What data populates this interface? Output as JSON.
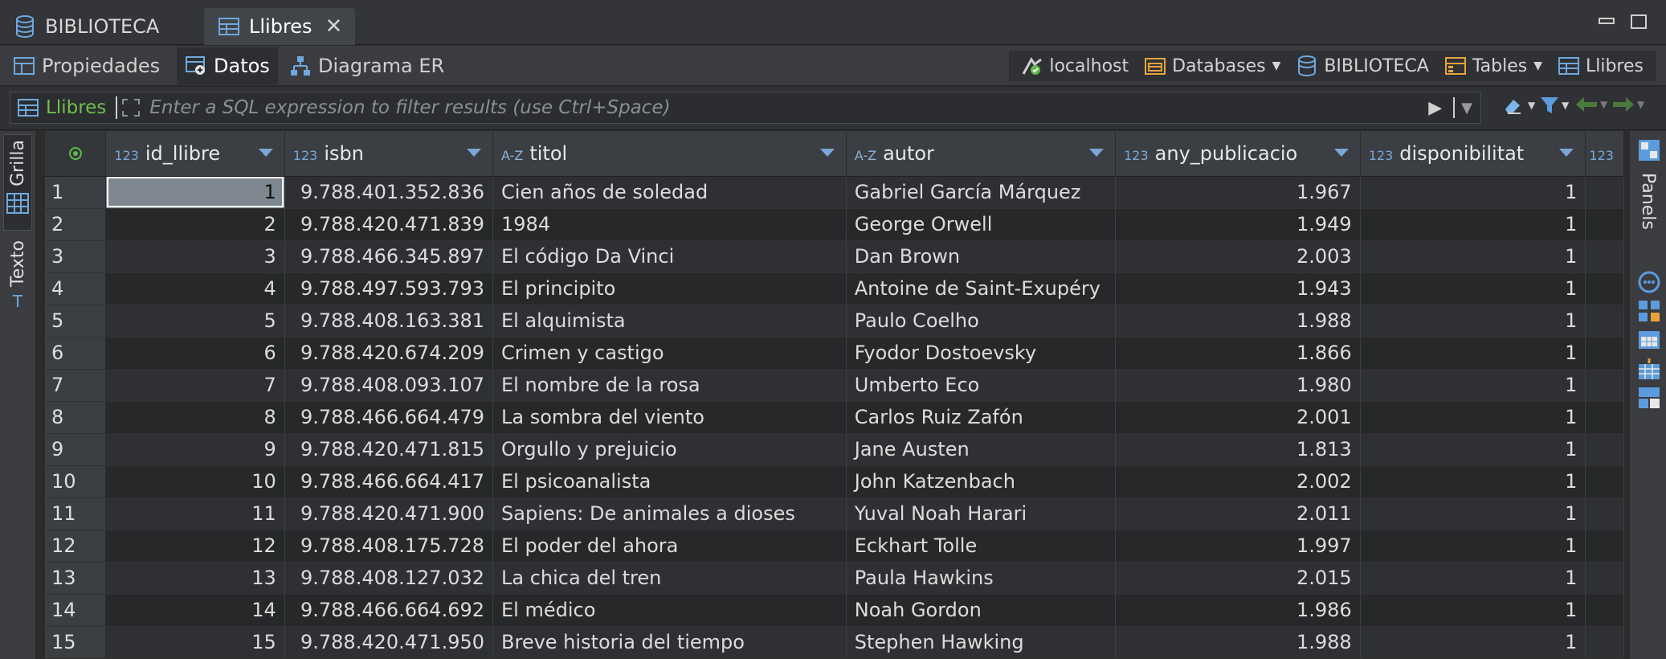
{
  "tabs": [
    {
      "label": "BIBLIOTECA",
      "icon": "database-icon",
      "active": false
    },
    {
      "label": "Llibres",
      "icon": "table-icon",
      "active": true
    }
  ],
  "subtabs": [
    {
      "label": "Propiedades",
      "icon": "properties-icon"
    },
    {
      "label": "Datos",
      "icon": "data-icon"
    },
    {
      "label": "Diagrama ER",
      "icon": "er-diagram-icon"
    }
  ],
  "breadcrumb": [
    {
      "label": "localhost",
      "icon": "connection-icon",
      "dropdown": false
    },
    {
      "label": "Databases",
      "icon": "folder-icon",
      "dropdown": true
    },
    {
      "label": "BIBLIOTECA",
      "icon": "database-icon",
      "dropdown": false
    },
    {
      "label": "Tables",
      "icon": "tables-folder-icon",
      "dropdown": true
    },
    {
      "label": "Llibres",
      "icon": "table-icon",
      "dropdown": false
    }
  ],
  "filter": {
    "table": "Llibres",
    "placeholder": "Enter a SQL expression to filter results (use Ctrl+Space)"
  },
  "side_tabs": {
    "grid": "Grilla",
    "text": "Texto",
    "panels": "Panels"
  },
  "columns": [
    {
      "name": "id_llibre",
      "type": "123",
      "key": true
    },
    {
      "name": "isbn",
      "type": "123",
      "key": true
    },
    {
      "name": "titol",
      "type": "A-Z",
      "key": false
    },
    {
      "name": "autor",
      "type": "A-Z",
      "key": false
    },
    {
      "name": "any_publicacio",
      "type": "123",
      "key": false
    },
    {
      "name": "disponibilitat",
      "type": "123",
      "key": false
    },
    {
      "name": "",
      "type": "123",
      "key": false
    }
  ],
  "rows": [
    {
      "n": "1",
      "id": "1",
      "isbn": "9.788.401.352.836",
      "titol": "Cien años de soledad",
      "autor": "Gabriel García Márquez",
      "any": "1.967",
      "disp": "1"
    },
    {
      "n": "2",
      "id": "2",
      "isbn": "9.788.420.471.839",
      "titol": "1984",
      "autor": "George Orwell",
      "any": "1.949",
      "disp": "1"
    },
    {
      "n": "3",
      "id": "3",
      "isbn": "9.788.466.345.897",
      "titol": "El código Da Vinci",
      "autor": "Dan Brown",
      "any": "2.003",
      "disp": "1"
    },
    {
      "n": "4",
      "id": "4",
      "isbn": "9.788.497.593.793",
      "titol": "El principito",
      "autor": "Antoine de Saint-Exupéry",
      "any": "1.943",
      "disp": "1"
    },
    {
      "n": "5",
      "id": "5",
      "isbn": "9.788.408.163.381",
      "titol": "El alquimista",
      "autor": "Paulo Coelho",
      "any": "1.988",
      "disp": "1"
    },
    {
      "n": "6",
      "id": "6",
      "isbn": "9.788.420.674.209",
      "titol": "Crimen y castigo",
      "autor": "Fyodor Dostoevsky",
      "any": "1.866",
      "disp": "1"
    },
    {
      "n": "7",
      "id": "7",
      "isbn": "9.788.408.093.107",
      "titol": "El nombre de la rosa",
      "autor": "Umberto Eco",
      "any": "1.980",
      "disp": "1"
    },
    {
      "n": "8",
      "id": "8",
      "isbn": "9.788.466.664.479",
      "titol": "La sombra del viento",
      "autor": "Carlos Ruiz Zafón",
      "any": "2.001",
      "disp": "1"
    },
    {
      "n": "9",
      "id": "9",
      "isbn": "9.788.420.471.815",
      "titol": "Orgullo y prejuicio",
      "autor": "Jane Austen",
      "any": "1.813",
      "disp": "1"
    },
    {
      "n": "10",
      "id": "10",
      "isbn": "9.788.466.664.417",
      "titol": "El psicoanalista",
      "autor": "John Katzenbach",
      "any": "2.002",
      "disp": "1"
    },
    {
      "n": "11",
      "id": "11",
      "isbn": "9.788.420.471.900",
      "titol": "Sapiens: De animales a dioses",
      "autor": "Yuval Noah Harari",
      "any": "2.011",
      "disp": "1"
    },
    {
      "n": "12",
      "id": "12",
      "isbn": "9.788.408.175.728",
      "titol": "El poder del ahora",
      "autor": "Eckhart Tolle",
      "any": "1.997",
      "disp": "1"
    },
    {
      "n": "13",
      "id": "13",
      "isbn": "9.788.408.127.032",
      "titol": "La chica del tren",
      "autor": "Paula Hawkins",
      "any": "2.015",
      "disp": "1"
    },
    {
      "n": "14",
      "id": "14",
      "isbn": "9.788.466.664.692",
      "titol": "El médico",
      "autor": "Noah Gordon",
      "any": "1.986",
      "disp": "1"
    },
    {
      "n": "15",
      "id": "15",
      "isbn": "9.788.420.471.950",
      "titol": "Breve historia del tiempo",
      "autor": "Stephen Hawking",
      "any": "1.988",
      "disp": "1"
    }
  ],
  "colors": {
    "accent": "#4a90d9",
    "filter_table": "#6fbf4f",
    "selected_cell": "#7e8790"
  }
}
